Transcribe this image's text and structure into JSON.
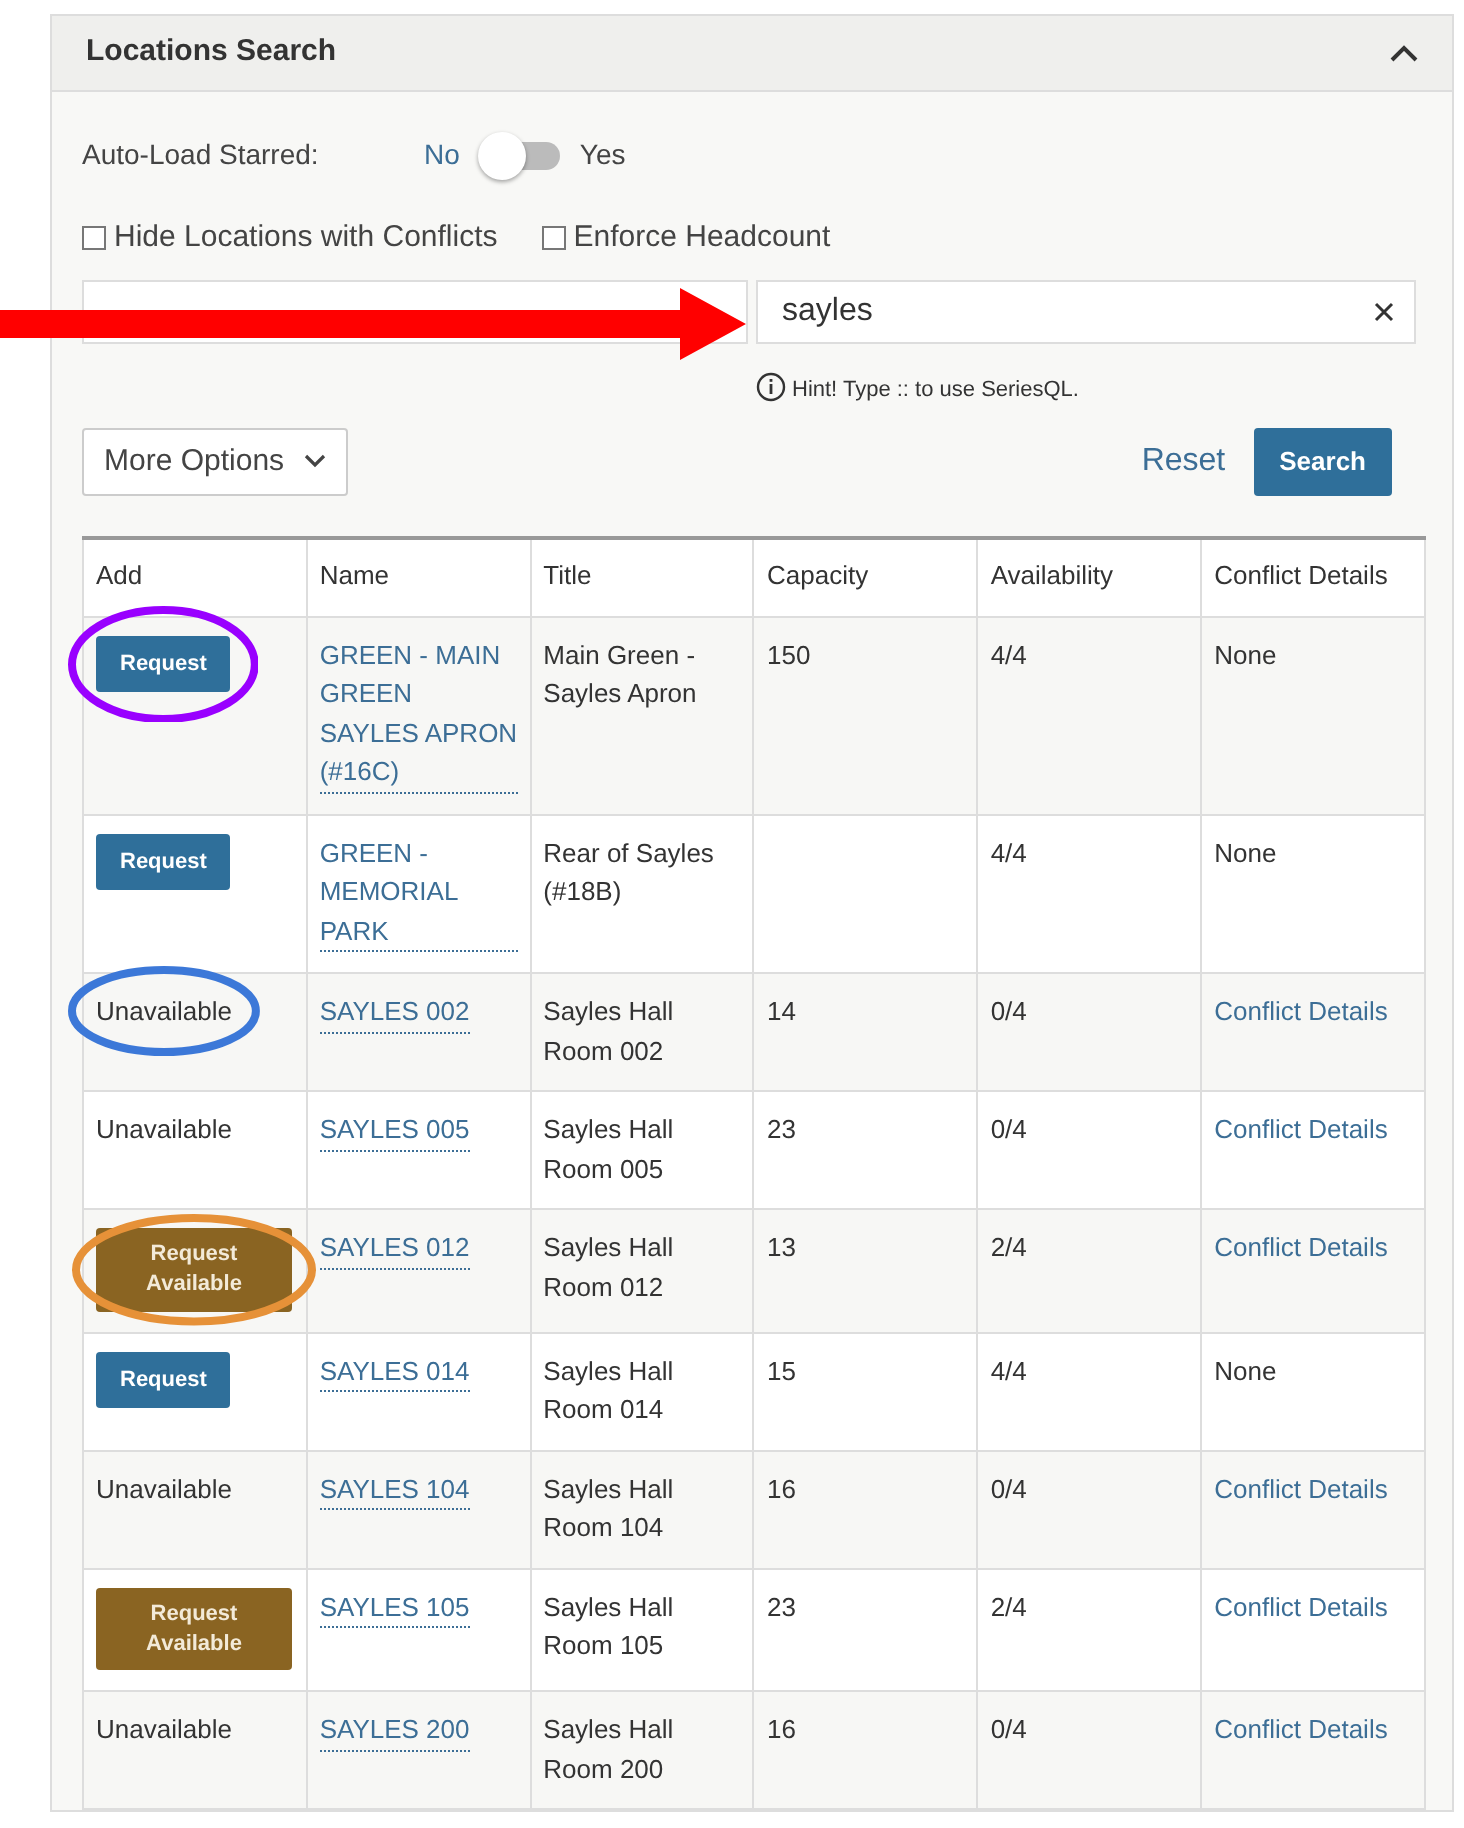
{
  "panel": {
    "title": "Locations Search",
    "expanded": true
  },
  "auto_load": {
    "label": "Auto-Load Starred:",
    "off_label": "No",
    "on_label": "Yes",
    "on": false
  },
  "checkboxes": [
    {
      "label": "Hide Locations with Conflicts",
      "checked": false
    },
    {
      "label": "Enforce Headcount",
      "checked": false
    }
  ],
  "search": {
    "value": "sayles",
    "hint": "Hint! Type :: to use SeriesQL."
  },
  "buttons": {
    "more_options": "More Options",
    "reset": "Reset",
    "search": "Search"
  },
  "table": {
    "columns": [
      "Add",
      "Name",
      "Title",
      "Capacity",
      "Availability",
      "Conflict Details"
    ],
    "rows": [
      {
        "add": {
          "kind": "request",
          "text": "Request"
        },
        "name": "GREEN - MAIN GREEN SAYLES APRON (#16C)",
        "title": "Main Green - Sayles Apron",
        "capacity": "150",
        "availability": "4/4",
        "conflict": {
          "kind": "text",
          "text": "None"
        }
      },
      {
        "add": {
          "kind": "request",
          "text": "Request"
        },
        "name": "GREEN - MEMORIAL PARK",
        "title": "Rear of Sayles (#18B)",
        "availability": "4/4",
        "conflict": {
          "kind": "text",
          "text": "None"
        }
      },
      {
        "add": {
          "kind": "unavailable",
          "text": "Unavailable"
        },
        "name": "SAYLES 002",
        "title": "Sayles Hall Room 002",
        "capacity": "14",
        "availability": "0/4",
        "conflict": {
          "kind": "link",
          "text": "Conflict Details"
        }
      },
      {
        "add": {
          "kind": "unavailable",
          "text": "Unavailable"
        },
        "name": "SAYLES 005",
        "title": "Sayles Hall Room 005",
        "capacity": "23",
        "availability": "0/4",
        "conflict": {
          "kind": "link",
          "text": "Conflict Details"
        }
      },
      {
        "add": {
          "kind": "request_available",
          "text": "Request Available"
        },
        "name": "SAYLES 012",
        "title": "Sayles Hall Room 012",
        "capacity": "13",
        "availability": "2/4",
        "conflict": {
          "kind": "link",
          "text": "Conflict Details"
        }
      },
      {
        "add": {
          "kind": "request",
          "text": "Request"
        },
        "name": "SAYLES 014",
        "title": "Sayles Hall Room 014",
        "capacity": "15",
        "availability": "4/4",
        "conflict": {
          "kind": "text",
          "text": "None"
        }
      },
      {
        "add": {
          "kind": "unavailable",
          "text": "Unavailable"
        },
        "name": "SAYLES 104",
        "title": "Sayles Hall Room 104",
        "capacity": "16",
        "availability": "0/4",
        "conflict": {
          "kind": "link",
          "text": "Conflict Details"
        }
      },
      {
        "add": {
          "kind": "request_available",
          "text": "Request Available"
        },
        "name": "SAYLES 105",
        "title": "Sayles Hall Room 105",
        "capacity": "23",
        "availability": "2/4",
        "conflict": {
          "kind": "link",
          "text": "Conflict Details"
        }
      },
      {
        "add": {
          "kind": "unavailable",
          "text": "Unavailable"
        },
        "name": "SAYLES 200",
        "title": "Sayles Hall Room 200",
        "capacity": "16",
        "availability": "0/4",
        "conflict": {
          "kind": "link",
          "text": "Conflict Details"
        }
      }
    ]
  },
  "annotations": [
    {
      "kind": "arrow",
      "color": "#ff0000"
    },
    {
      "kind": "ellipse",
      "color": "#9900ff"
    },
    {
      "kind": "ellipse",
      "color": "#3c78d8"
    },
    {
      "kind": "ellipse",
      "color": "#e69138"
    }
  ]
}
